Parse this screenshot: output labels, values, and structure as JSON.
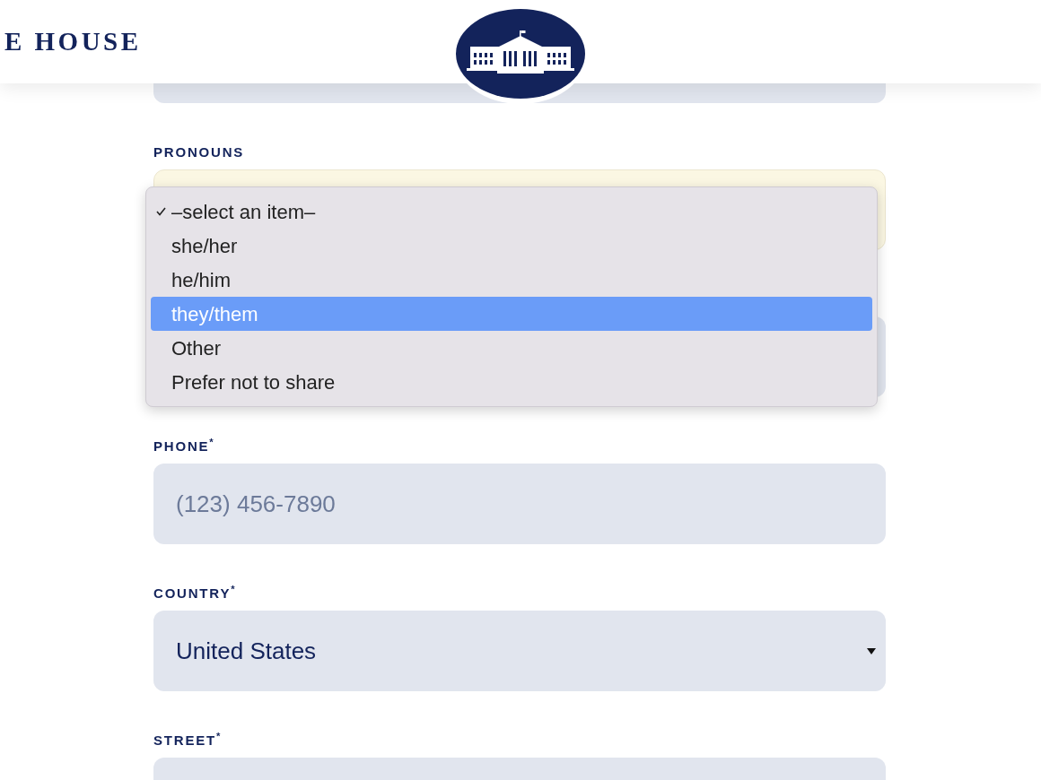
{
  "header": {
    "site_title": "E HOUSE"
  },
  "fields": [
    {
      "kind": "text",
      "focused": false
    },
    {
      "kind": "select",
      "label": "PRONOUNS",
      "focused": true
    },
    {
      "kind": "text",
      "focused": false
    },
    {
      "kind": "text",
      "label": "PHONE$^{*}$",
      "placeholder": "(123) 456-7890",
      "focused": false
    },
    {
      "kind": "select",
      "label": "COUNTRY$^{*}$",
      "value": "United States",
      "focused": false
    },
    {
      "kind": "text",
      "label": "STREET$^{*}$",
      "focused": false
    }
  ],
  "dropdown": {
    "options": [
      {
        "label": "–select an item–",
        "checked": true,
        "selected": false
      },
      {
        "label": "she/her",
        "checked": false,
        "selected": false
      },
      {
        "label": "he/him",
        "checked": false,
        "selected": false
      },
      {
        "label": "they/them",
        "checked": false,
        "selected": true
      },
      {
        "label": "Other",
        "checked": false,
        "selected": false
      },
      {
        "label": "Prefer not to share",
        "checked": false,
        "selected": false
      }
    ]
  }
}
